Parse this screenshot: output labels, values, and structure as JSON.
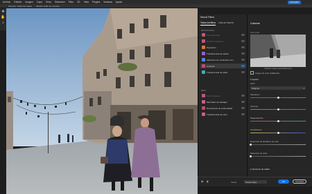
{
  "menubar": {
    "items": [
      "Archivo",
      "Edición",
      "Imagen",
      "Capa",
      "Texto",
      "Selección",
      "Filtro",
      "3D",
      "Vista",
      "Plugins",
      "Ventana",
      "Ayuda"
    ],
    "share_label": "Compartir"
  },
  "options_bar": {
    "items": [
      "Muestra: Todas las capas",
      "Mostrar anillo de muestra"
    ]
  },
  "neural_filters": {
    "title": "Neural Filters",
    "tabs": [
      "Todos los filtros",
      "Lista de espera"
    ],
    "section_featured": "DESTACADOS",
    "section_beta": "BETA",
    "featured": [
      {
        "label": "Piel suavizada",
        "enabled": false,
        "color": "#c0567a",
        "dim": true
      },
      {
        "label": "Retrato inteligente",
        "enabled": false,
        "color": "#c0567a",
        "dim": true
      },
      {
        "label": "Supresión",
        "enabled": false,
        "color": "#d07a3a",
        "dim": false
      },
      {
        "label": "Transferencia de estilos",
        "enabled": false,
        "color": "#9a5ec8",
        "dim": false
      },
      {
        "label": "Ultrazoom de resolución (4×)",
        "enabled": false,
        "color": "#5b82d6",
        "dim": false
      },
      {
        "label": "Colorear",
        "enabled": true,
        "color": "#c04a6a",
        "dim": false
      },
      {
        "label": "Transferencia de estilo",
        "enabled": false,
        "color": "#4aa8b8",
        "dim": false
      }
    ],
    "beta": [
      {
        "label": "Fotos antiguas",
        "enabled": false,
        "color": "#c0567a",
        "dim": true
      },
      {
        "label": "Mezclador de paisajes",
        "enabled": false,
        "color": "#c95f8a",
        "dim": false
      },
      {
        "label": "Desenfoque de profundidad",
        "enabled": false,
        "color": "#c04a6a",
        "dim": false
      },
      {
        "label": "Transferencia de color",
        "enabled": false,
        "color": "#c95f8a",
        "dim": false
      }
    ]
  },
  "colorize": {
    "title": "Colorear",
    "preview_label": "Auto-Color",
    "caption": "Colorear imagen automáticamente",
    "checkbox_label": "Imagen de color establecido",
    "adjust_header": "Ajustes",
    "profile_label": "Perfil",
    "profile_value": "Ninguno",
    "sliders": [
      {
        "label": "Saturación",
        "value": 0,
        "min": -50,
        "max": 50,
        "gradient": [
          "#2e7d8a",
          "#c55a5a"
        ]
      },
      {
        "label": "Cian/rojo",
        "value": 0,
        "min": -50,
        "max": 50,
        "gradient": [
          "#2aa6b5",
          "#c24b4b"
        ]
      },
      {
        "label": "Magenta/verde",
        "value": 0,
        "min": -50,
        "max": 50,
        "gradient": [
          "#b542a8",
          "#3fa64a"
        ]
      },
      {
        "label": "Amarillo/azul",
        "value": 0,
        "min": -50,
        "max": 50,
        "gradient": [
          "#c8b23a",
          "#3b57c9"
        ]
      },
      {
        "label": "Reducción de artefactos de color",
        "value": 0,
        "min": 0,
        "max": 100,
        "gradient": [
          "#555555",
          "#9a9a9a"
        ]
      },
      {
        "label": "Reducción de ruido",
        "value": 0,
        "min": 0,
        "max": 100,
        "gradient": [
          "#555555",
          "#9a9a9a"
        ]
      }
    ],
    "adv_header": "Opciones de salida"
  },
  "bottom": {
    "output_label": "Salida",
    "output_value": "Nueva capa",
    "ok_label": "OK",
    "cancel_label": "Cancelar"
  },
  "colors": {
    "accent": "#1473e6",
    "panel": "#262626",
    "chrome": "#2b2b2b"
  }
}
